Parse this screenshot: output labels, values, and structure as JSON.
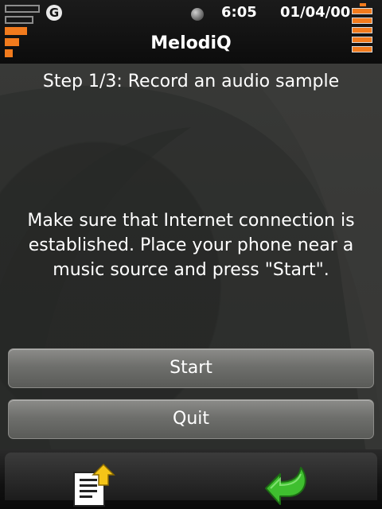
{
  "status_bar": {
    "network_letter": "G",
    "time": "6:05",
    "date": "01/04/00",
    "icons": [
      "signal-strength-icon",
      "network-g-icon",
      "status-dot-icon",
      "battery-icon"
    ]
  },
  "app": {
    "title": "MelodiQ"
  },
  "content": {
    "step": "Step 1/3: Record an audio sample",
    "instructions": "Make sure that Internet connection is established. Place your phone near a music source and press \"Start\"."
  },
  "buttons": {
    "start": "Start",
    "quit": "Quit"
  },
  "softkeys": {
    "left_icon": "document-upload-icon",
    "right_icon": "back-arrow-icon"
  },
  "colors": {
    "accent": "#f27b1d",
    "back_arrow": "#3fbf2f"
  }
}
